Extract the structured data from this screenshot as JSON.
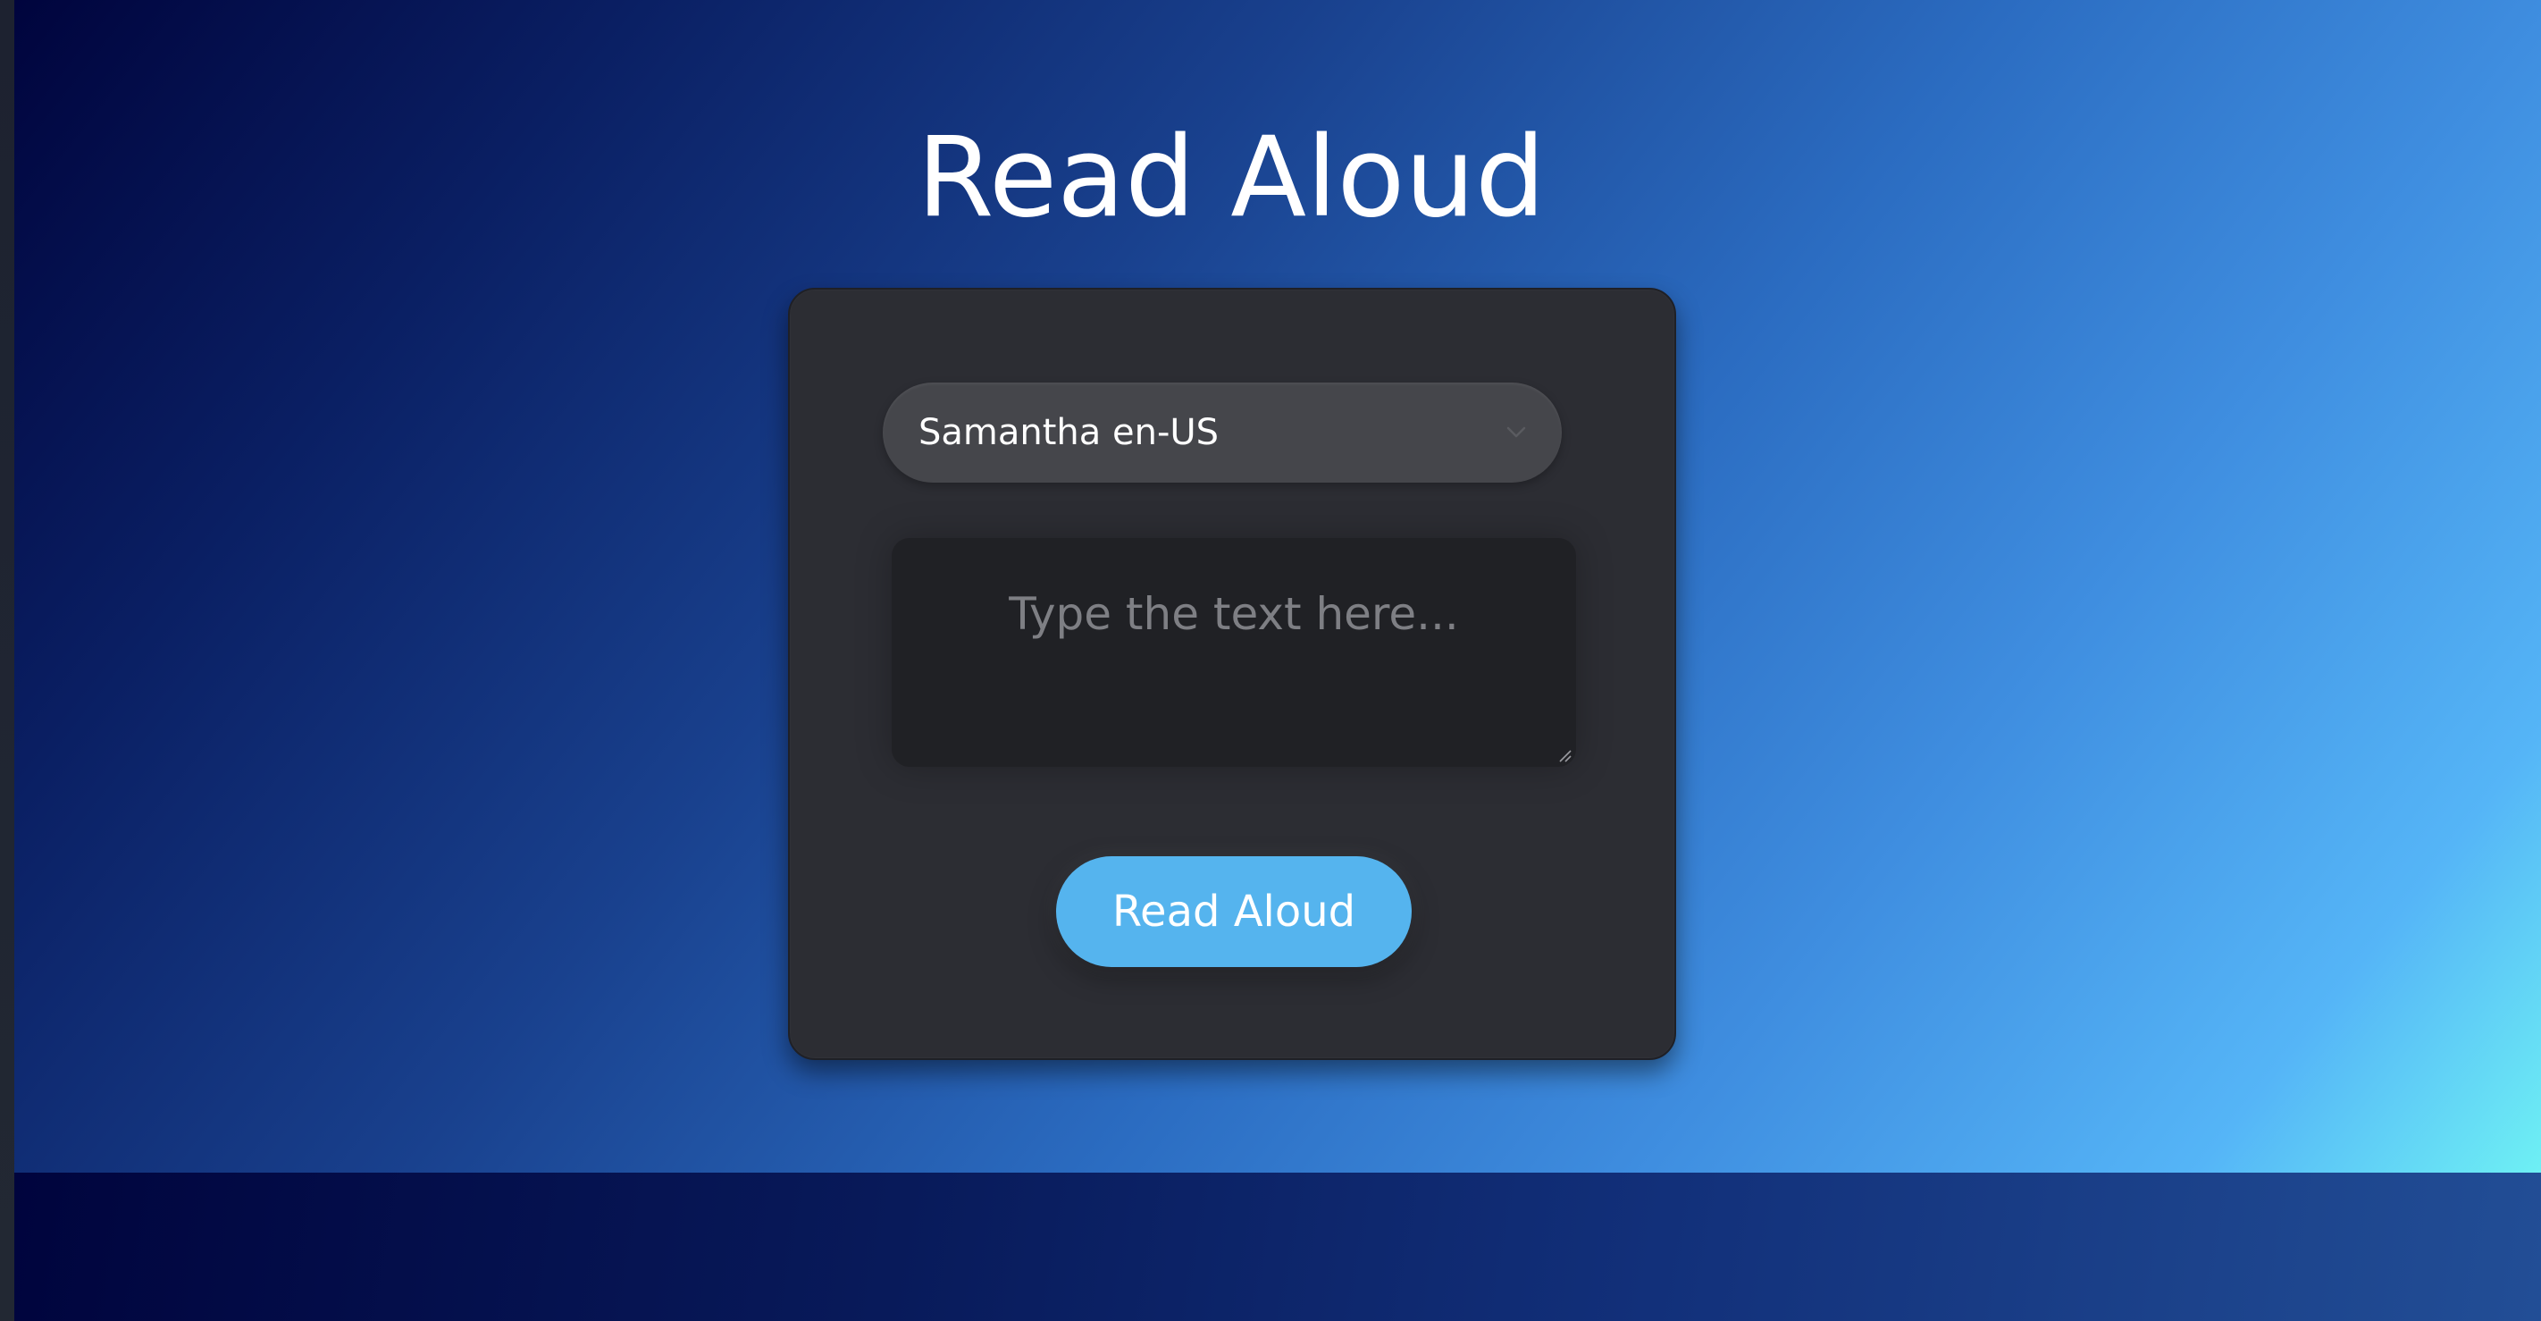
{
  "page": {
    "title": "Read Aloud"
  },
  "voice_select": {
    "selected": "Samantha en-US",
    "icon": "chevron-down-icon"
  },
  "text_input": {
    "value": "",
    "placeholder": "Type the text here..."
  },
  "actions": {
    "read_label": "Read Aloud"
  },
  "colors": {
    "card_background": "#2c2d33",
    "select_background": "#45464b",
    "textarea_background": "#202125",
    "button_background": "#55b4ee",
    "gradient_start": "#00043d",
    "gradient_end": "#6ef0f4"
  }
}
